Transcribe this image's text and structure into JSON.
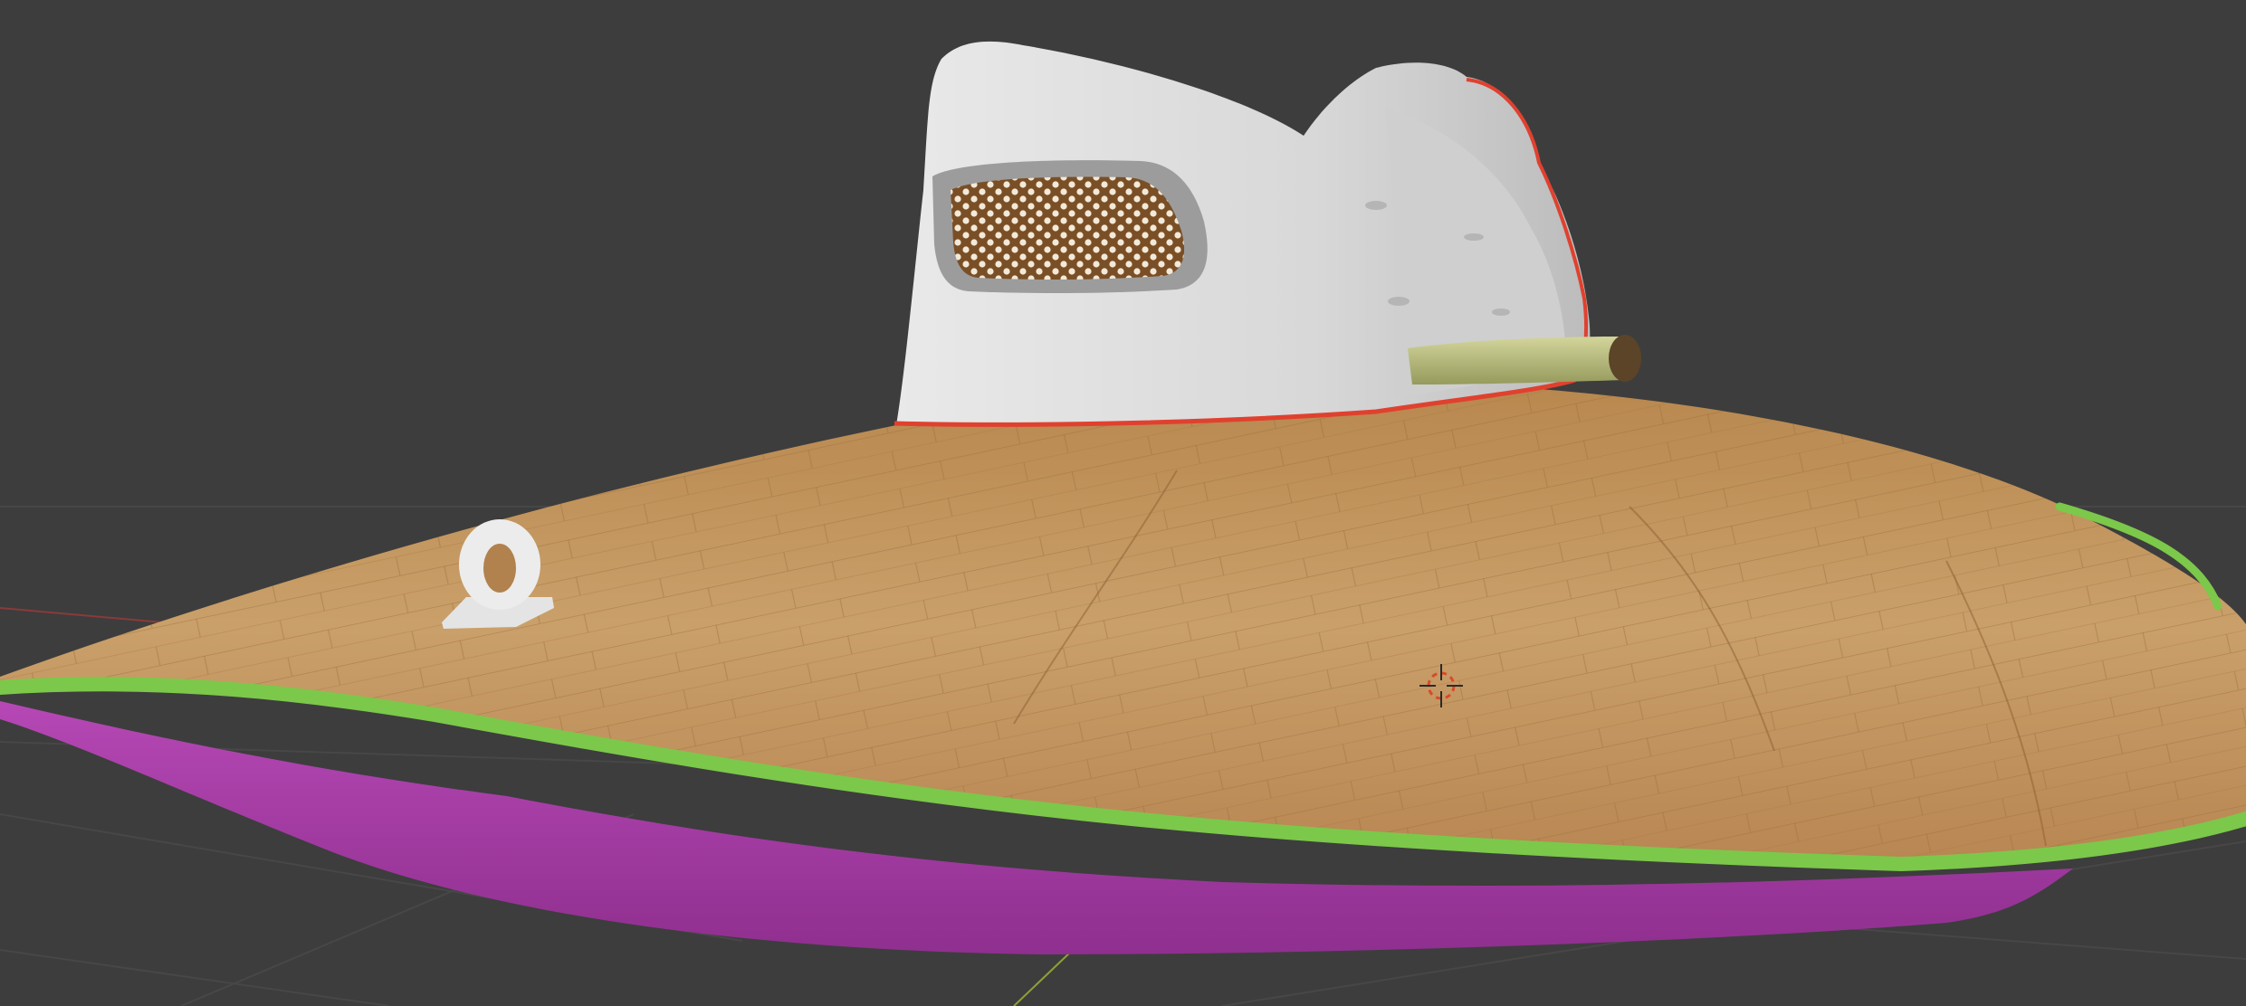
{
  "app": {
    "name": "3D viewport",
    "view_mode": "material-preview"
  },
  "scene": {
    "objects": [
      {
        "name": "hull-body",
        "color": "#a33aa3"
      },
      {
        "name": "gunwale-trim",
        "color": "#7dc74a"
      },
      {
        "name": "wooden-deck",
        "color": "#c8955c"
      },
      {
        "name": "cabin",
        "color": "#d9d9d9"
      },
      {
        "name": "cabin-base-trim",
        "color": "#e0412f"
      },
      {
        "name": "vent-grille",
        "color": "#8b5a2b"
      },
      {
        "name": "exhaust-pipe",
        "color": "#b7bd7e"
      },
      {
        "name": "mooring-ring",
        "color": "#e6e6e6"
      }
    ],
    "cursor_icon": "3d-cursor-icon",
    "grid_color": "#474747",
    "background_color": "#3d3d3d"
  }
}
